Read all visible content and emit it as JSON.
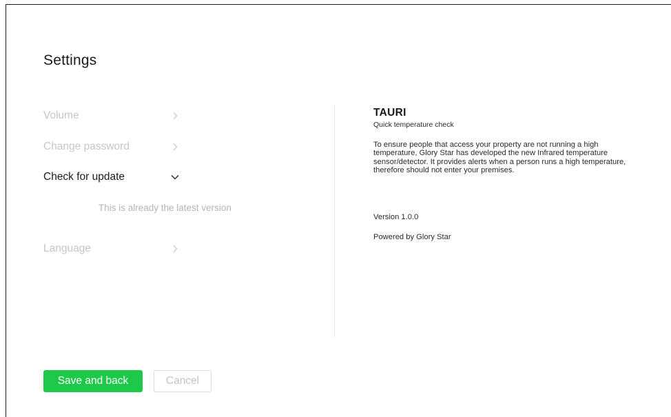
{
  "page": {
    "title": "Settings"
  },
  "menu": {
    "items": [
      {
        "label": "Volume",
        "state": "collapsed"
      },
      {
        "label": "Change password",
        "state": "collapsed"
      },
      {
        "label": "Check for update",
        "state": "expanded"
      },
      {
        "label": "Language",
        "state": "collapsed"
      }
    ],
    "update_status": "This is already the latest version"
  },
  "info": {
    "app_name": "TAURI",
    "tagline": "Quick temperature check",
    "description": "To ensure people that access your property are not running a high temperature, Glory Star has developed the new Infrared temperature sensor/detector. It provides alerts when a person runs a high temperature, therefore should not enter your premises.",
    "version": "Version 1.0.0",
    "powered_by": "Powered by Glory Star"
  },
  "actions": {
    "save_label": "Save and back",
    "cancel_label": "Cancel"
  },
  "colors": {
    "accent": "#1ec94a",
    "text_primary": "#1b1b1b",
    "text_muted": "#c6c6c6"
  },
  "icons": {
    "collapsed": "chevron-right-icon",
    "expanded": "chevron-down-icon"
  }
}
